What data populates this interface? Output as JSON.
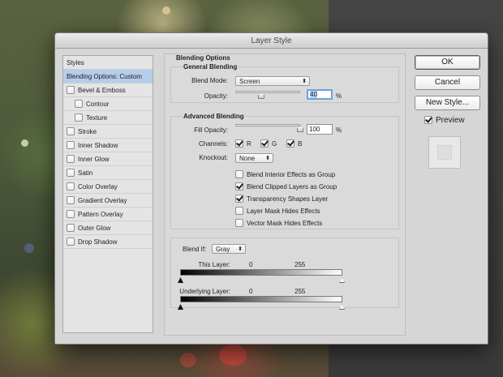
{
  "window": {
    "title": "Layer Style"
  },
  "styles_list": {
    "header": "Styles",
    "items": [
      {
        "label": "Blending Options: Custom",
        "has_checkbox": false,
        "checked": false,
        "indent": 0,
        "selected": true
      },
      {
        "label": "Bevel & Emboss",
        "has_checkbox": true,
        "checked": false,
        "indent": 0,
        "selected": false
      },
      {
        "label": "Contour",
        "has_checkbox": true,
        "checked": false,
        "indent": 1,
        "selected": false
      },
      {
        "label": "Texture",
        "has_checkbox": true,
        "checked": false,
        "indent": 1,
        "selected": false
      },
      {
        "label": "Stroke",
        "has_checkbox": true,
        "checked": false,
        "indent": 0,
        "selected": false
      },
      {
        "label": "Inner Shadow",
        "has_checkbox": true,
        "checked": false,
        "indent": 0,
        "selected": false
      },
      {
        "label": "Inner Glow",
        "has_checkbox": true,
        "checked": false,
        "indent": 0,
        "selected": false
      },
      {
        "label": "Satin",
        "has_checkbox": true,
        "checked": false,
        "indent": 0,
        "selected": false
      },
      {
        "label": "Color Overlay",
        "has_checkbox": true,
        "checked": false,
        "indent": 0,
        "selected": false
      },
      {
        "label": "Gradient Overlay",
        "has_checkbox": true,
        "checked": false,
        "indent": 0,
        "selected": false
      },
      {
        "label": "Pattern Overlay",
        "has_checkbox": true,
        "checked": false,
        "indent": 0,
        "selected": false
      },
      {
        "label": "Outer Glow",
        "has_checkbox": true,
        "checked": false,
        "indent": 0,
        "selected": false
      },
      {
        "label": "Drop Shadow",
        "has_checkbox": true,
        "checked": false,
        "indent": 0,
        "selected": false
      }
    ]
  },
  "blending_options": {
    "title": "Blending Options",
    "general": {
      "title": "General Blending",
      "blend_mode_label": "Blend Mode:",
      "blend_mode_value": "Screen",
      "opacity_label": "Opacity:",
      "opacity_value": "40",
      "opacity_fraction": 0.4,
      "percent": "%"
    },
    "advanced": {
      "title": "Advanced Blending",
      "fill_opacity_label": "Fill Opacity:",
      "fill_opacity_value": "100",
      "fill_opacity_fraction": 1.0,
      "percent": "%",
      "channels_label": "Channels:",
      "channels": [
        {
          "label": "R",
          "checked": true
        },
        {
          "label": "G",
          "checked": true
        },
        {
          "label": "B",
          "checked": true
        }
      ],
      "knockout_label": "Knockout:",
      "knockout_value": "None",
      "options": [
        {
          "label": "Blend Interior Effects as Group",
          "checked": false
        },
        {
          "label": "Blend Clipped Layers as Group",
          "checked": true
        },
        {
          "label": "Transparency Shapes Layer",
          "checked": true
        },
        {
          "label": "Layer Mask Hides Effects",
          "checked": false
        },
        {
          "label": "Vector Mask Hides Effects",
          "checked": false
        }
      ]
    },
    "blend_if": {
      "label": "Blend If:",
      "value": "Gray",
      "this_layer": {
        "label": "This Layer:",
        "low": "0",
        "high": "255"
      },
      "underlying_layer": {
        "label": "Underlying Layer:",
        "low": "0",
        "high": "255"
      }
    }
  },
  "buttons": {
    "ok": "OK",
    "cancel": "Cancel",
    "new_style": "New Style...",
    "preview_label": "Preview",
    "preview_checked": true
  }
}
